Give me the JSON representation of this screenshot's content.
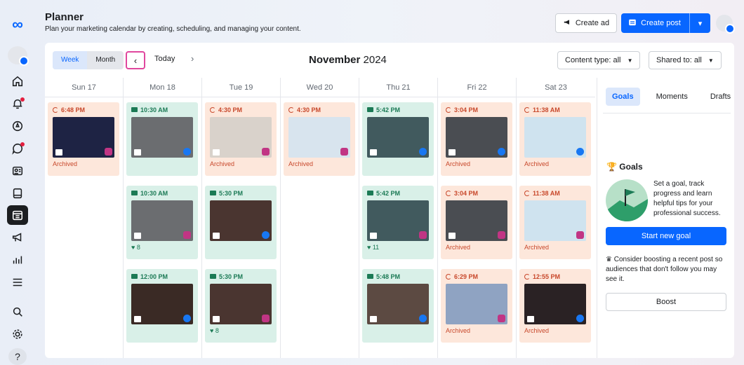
{
  "header": {
    "title": "Planner",
    "subtitle": "Plan your marketing calendar by creating, scheduling, and managing your content."
  },
  "actions": {
    "create_ad": "Create ad",
    "create_post": "Create post"
  },
  "toolbar": {
    "view_week": "Week",
    "view_month": "Month",
    "view_selected": "Week",
    "today": "Today",
    "month": "November",
    "year": "2024",
    "content_type": "Content type: all",
    "shared_to": "Shared to: all"
  },
  "days": [
    {
      "label": "Sun 17"
    },
    {
      "label": "Mon 18"
    },
    {
      "label": "Tue 19"
    },
    {
      "label": "Wed 20"
    },
    {
      "label": "Thu 21"
    },
    {
      "label": "Fri 22"
    },
    {
      "label": "Sat 23"
    }
  ],
  "posts": [
    {
      "day": 0,
      "slot": 0,
      "status": "scheduled",
      "time": "6:48 PM",
      "foot": "Archived",
      "platform": "instagram",
      "media": "video",
      "thumb": "#1e2344"
    },
    {
      "day": 1,
      "slot": 0,
      "status": "published",
      "time": "10:30 AM",
      "foot": "",
      "platform": "facebook",
      "media": "photo",
      "thumb": "#6b6d70"
    },
    {
      "day": 1,
      "slot": 1,
      "status": "published",
      "time": "10:30 AM",
      "foot": "♥ 8",
      "platform": "instagram",
      "media": "photo",
      "thumb": "#6b6d70"
    },
    {
      "day": 1,
      "slot": 2,
      "status": "published",
      "time": "12:00 PM",
      "foot": "",
      "platform": "facebook",
      "media": "photo",
      "thumb": "#3a2a25"
    },
    {
      "day": 2,
      "slot": 0,
      "status": "scheduled",
      "time": "4:30 PM",
      "foot": "Archived",
      "platform": "instagram",
      "media": "carousel",
      "thumb": "#d9d2cb"
    },
    {
      "day": 2,
      "slot": 1,
      "status": "published",
      "time": "5:30 PM",
      "foot": "",
      "platform": "facebook",
      "media": "photo",
      "thumb": "#4a3530"
    },
    {
      "day": 2,
      "slot": 2,
      "status": "published",
      "time": "5:30 PM",
      "foot": "♥ 8",
      "platform": "instagram",
      "media": "photo",
      "thumb": "#4a3530"
    },
    {
      "day": 3,
      "slot": 0,
      "status": "scheduled",
      "time": "4:30 PM",
      "foot": "Archived",
      "platform": "instagram",
      "media": "",
      "thumb": "#d8e4ee"
    },
    {
      "day": 4,
      "slot": 0,
      "status": "published",
      "time": "5:42 PM",
      "foot": "",
      "platform": "facebook",
      "media": "photo",
      "thumb": "#415a5e"
    },
    {
      "day": 4,
      "slot": 1,
      "status": "published",
      "time": "5:42 PM",
      "foot": "♥ 11",
      "platform": "instagram",
      "media": "photo",
      "thumb": "#415a5e"
    },
    {
      "day": 4,
      "slot": 2,
      "status": "published",
      "time": "5:48 PM",
      "foot": "",
      "platform": "facebook",
      "media": "reel",
      "thumb": "#5c4a42"
    },
    {
      "day": 5,
      "slot": 0,
      "status": "scheduled",
      "time": "3:04 PM",
      "foot": "Archived",
      "platform": "facebook",
      "media": "video",
      "thumb": "#4a4d52"
    },
    {
      "day": 5,
      "slot": 1,
      "status": "scheduled",
      "time": "3:04 PM",
      "foot": "Archived",
      "platform": "instagram",
      "media": "video",
      "thumb": "#4a4d52"
    },
    {
      "day": 5,
      "slot": 2,
      "status": "scheduled",
      "time": "6:29 PM",
      "foot": "Archived",
      "platform": "instagram",
      "media": "",
      "thumb": "#8fa3c2"
    },
    {
      "day": 6,
      "slot": 0,
      "status": "scheduled",
      "time": "11:38 AM",
      "foot": "Archived",
      "platform": "facebook",
      "media": "",
      "thumb": "#cfe3ef"
    },
    {
      "day": 6,
      "slot": 1,
      "status": "scheduled",
      "time": "11:38 AM",
      "foot": "Archived",
      "platform": "instagram",
      "media": "",
      "thumb": "#cfe3ef"
    },
    {
      "day": 6,
      "slot": 2,
      "status": "scheduled",
      "time": "12:55 PM",
      "foot": "Archived",
      "platform": "facebook",
      "media": "video",
      "thumb": "#2a2224"
    }
  ],
  "panel": {
    "tabs": [
      "Goals",
      "Moments",
      "Drafts"
    ],
    "selected_tab": "Goals",
    "goals_title": "Goals",
    "goals_text": "Set a goal, track progress and learn helpful tips for your professional success.",
    "start_goal": "Start new goal",
    "boost_text": "Consider boosting a recent post so audiences that don't follow you may see it.",
    "boost": "Boost"
  },
  "colors": {
    "accent": "#0866ff",
    "scheduled_bg": "#fde7db",
    "published_bg": "#d9f0e8",
    "scheduled_text": "#c8482b",
    "published_text": "#1b7a55"
  },
  "rail_icons": [
    "home-icon",
    "bell-icon",
    "compass-icon",
    "chat-icon",
    "contacts-icon",
    "content-icon",
    "calendar-icon",
    "megaphone-icon",
    "insights-icon",
    "menu-icon",
    "search-icon",
    "settings-icon",
    "help-icon"
  ]
}
